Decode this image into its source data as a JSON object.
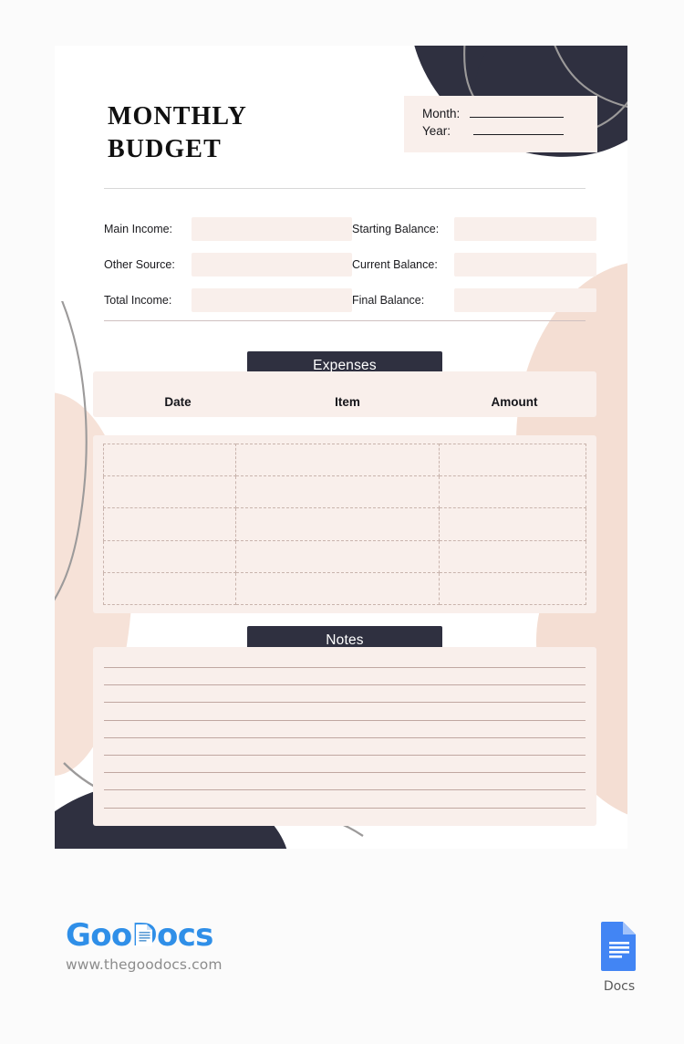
{
  "document": {
    "title_line1": "MONTHLY",
    "title_line2": "BUDGET"
  },
  "month_year": {
    "month_label": "Month:",
    "year_label": "Year:"
  },
  "income": {
    "rows": [
      {
        "left_label": "Main Income:",
        "right_label": "Starting Balance:"
      },
      {
        "left_label": "Other Source:",
        "right_label": "Current Balance:"
      },
      {
        "left_label": "Total Income:",
        "right_label": "Final Balance:"
      }
    ]
  },
  "expenses": {
    "badge_label": "Expenses",
    "columns": [
      "Date",
      "Item",
      "Amount"
    ],
    "row_count": 5,
    "rows": [
      {
        "date": "",
        "item": "",
        "amount": ""
      },
      {
        "date": "",
        "item": "",
        "amount": ""
      },
      {
        "date": "",
        "item": "",
        "amount": ""
      },
      {
        "date": "",
        "item": "",
        "amount": ""
      },
      {
        "date": "",
        "item": "",
        "amount": ""
      }
    ]
  },
  "notes": {
    "badge_label": "Notes",
    "line_count": 9,
    "lines": [
      "",
      "",
      "",
      "",
      "",
      "",
      "",
      "",
      ""
    ]
  },
  "footer": {
    "brand_goo": "Goo",
    "brand_docs": "Docs",
    "url": "www.thegoodocs.com",
    "docs_label": "Docs"
  },
  "colors": {
    "dark": "#2f3040",
    "field_pink": "#f9efeb",
    "blob_peach": "#f4ded3",
    "brand_blue": "#2f8fe8",
    "dashed_border": "#c9b4ad",
    "note_rule": "#c0a7a1"
  }
}
